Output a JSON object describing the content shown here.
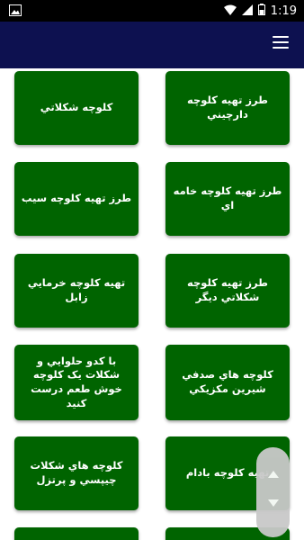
{
  "status_bar": {
    "time": "1:19"
  },
  "cards": [
    "طرز تهيه كلوچه دارچيني",
    "كلوچه شكلاتي",
    "طرز تهيه كلوچه خامه اي",
    "طرز تهيه كلوچه سيب",
    "طرز تهيه كلوچه شكلاتي ديگر",
    "تهيه كلوچه خرمايي زابل",
    "كلوچه هاي صدفي شيرين مكزيكي",
    "با كدو حلوايي و شكلات يک كلوچه خوش طعم درست كنيد",
    "تهيه كلوچه بادام",
    "كلوچه هاي شكلات چيپسي و پرتزل"
  ],
  "colors": {
    "appbar": "#0d1150",
    "card": "#006400"
  }
}
